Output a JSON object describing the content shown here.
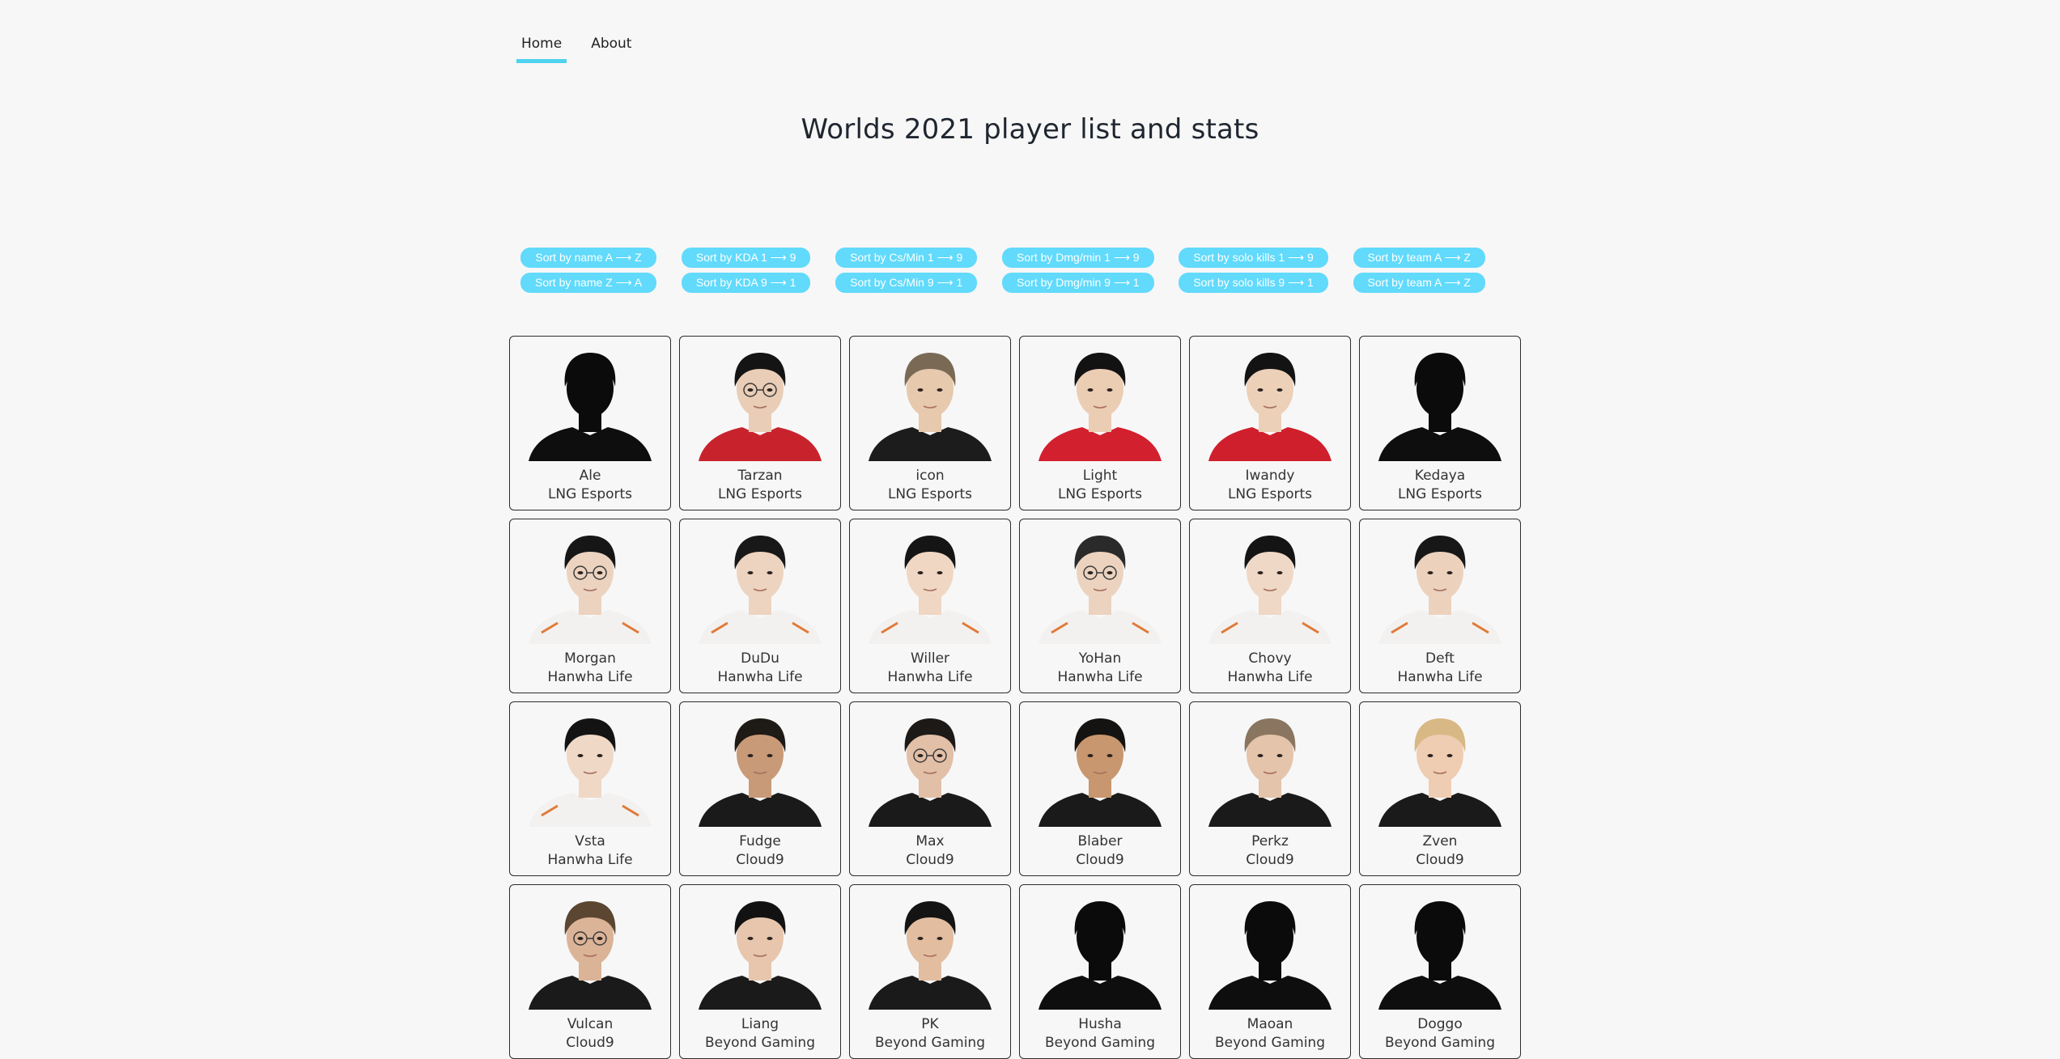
{
  "nav": {
    "items": [
      {
        "label": "Home",
        "active": true
      },
      {
        "label": "About",
        "active": false
      }
    ]
  },
  "title": "Worlds 2021 player list and stats",
  "sort_buttons": [
    [
      "Sort by name A ⟶ Z",
      "Sort by name Z ⟶ A"
    ],
    [
      "Sort by KDA 1 ⟶ 9",
      "Sort by KDA 9 ⟶ 1"
    ],
    [
      "Sort by Cs/Min 1 ⟶ 9",
      "Sort by Cs/Min 9 ⟶ 1"
    ],
    [
      "Sort by Dmg/min 1 ⟶ 9",
      "Sort by Dmg/min 9 ⟶ 1"
    ],
    [
      "Sort by solo kills 1 ⟶ 9",
      "Sort by solo kills 9 ⟶ 1"
    ],
    [
      "Sort by team A ⟶ Z",
      "Sort by team A ⟶ Z"
    ]
  ],
  "players": [
    {
      "name": "Ale",
      "team": "LNG Esports",
      "silhouette": true,
      "shirt": "#1a1a1a",
      "hair": "#111111",
      "skin": "#0c0c0c",
      "glasses": false
    },
    {
      "name": "Tarzan",
      "team": "LNG Esports",
      "silhouette": false,
      "shirt": "#c8232c",
      "hair": "#141414",
      "skin": "#e9cdb6",
      "glasses": true
    },
    {
      "name": "icon",
      "team": "LNG Esports",
      "silhouette": false,
      "shirt": "#1c1c1c",
      "hair": "#7a6a55",
      "skin": "#e7c9ae",
      "glasses": false
    },
    {
      "name": "Light",
      "team": "LNG Esports",
      "silhouette": false,
      "shirt": "#d3202e",
      "hair": "#121212",
      "skin": "#ebcdb4",
      "glasses": false
    },
    {
      "name": "Iwandy",
      "team": "LNG Esports",
      "silhouette": false,
      "shirt": "#d01f2c",
      "hair": "#131313",
      "skin": "#ecd0b8",
      "glasses": false
    },
    {
      "name": "Kedaya",
      "team": "LNG Esports",
      "silhouette": true,
      "shirt": "#1a1a1a",
      "hair": "#111111",
      "skin": "#0c0c0c",
      "glasses": false
    },
    {
      "name": "Morgan",
      "team": "Hanwha Life",
      "silhouette": false,
      "shirt": "#f3f1ef",
      "hair": "#161616",
      "skin": "#ecd3bf",
      "glasses": true
    },
    {
      "name": "DuDu",
      "team": "Hanwha Life",
      "silhouette": false,
      "shirt": "#f3f1ef",
      "hair": "#181818",
      "skin": "#edd4c0",
      "glasses": false
    },
    {
      "name": "Willer",
      "team": "Hanwha Life",
      "silhouette": false,
      "shirt": "#f3f1ef",
      "hair": "#151515",
      "skin": "#efd7c4",
      "glasses": false
    },
    {
      "name": "YoHan",
      "team": "Hanwha Life",
      "silhouette": false,
      "shirt": "#f3f1ef",
      "hair": "#2a2a2a",
      "skin": "#ecd3bf",
      "glasses": true
    },
    {
      "name": "Chovy",
      "team": "Hanwha Life",
      "silhouette": false,
      "shirt": "#f3f1ef",
      "hair": "#141414",
      "skin": "#efd8c6",
      "glasses": false
    },
    {
      "name": "Deft",
      "team": "Hanwha Life",
      "silhouette": false,
      "shirt": "#f3f1ef",
      "hair": "#171717",
      "skin": "#ecd2bd",
      "glasses": false
    },
    {
      "name": "Vsta",
      "team": "Hanwha Life",
      "silhouette": false,
      "shirt": "#f3f1ef",
      "hair": "#131313",
      "skin": "#efd8c6",
      "glasses": false
    },
    {
      "name": "Fudge",
      "team": "Cloud9",
      "silhouette": false,
      "shirt": "#1a1a1a",
      "hair": "#1e1a16",
      "skin": "#c99a78",
      "glasses": false
    },
    {
      "name": "Max",
      "team": "Cloud9",
      "silhouette": false,
      "shirt": "#1a1a1a",
      "hair": "#1c1917",
      "skin": "#e2bfa7",
      "glasses": true
    },
    {
      "name": "Blaber",
      "team": "Cloud9",
      "silhouette": false,
      "shirt": "#1a1a1a",
      "hair": "#151311",
      "skin": "#c8976f",
      "glasses": false
    },
    {
      "name": "Perkz",
      "team": "Cloud9",
      "silhouette": false,
      "shirt": "#1a1a1a",
      "hair": "#8a7560",
      "skin": "#e4c4ab",
      "glasses": false
    },
    {
      "name": "Zven",
      "team": "Cloud9",
      "silhouette": false,
      "shirt": "#1a1a1a",
      "hair": "#d8b884",
      "skin": "#efcdb3",
      "glasses": false
    },
    {
      "name": "Vulcan",
      "team": "Cloud9",
      "silhouette": false,
      "shirt": "#1a1a1a",
      "hair": "#5b4632",
      "skin": "#dbb397",
      "glasses": true
    },
    {
      "name": "Liang",
      "team": "Beyond Gaming",
      "silhouette": false,
      "shirt": "#1a1a1a",
      "hair": "#121212",
      "skin": "#e7c6ad",
      "glasses": false
    },
    {
      "name": "PK",
      "team": "Beyond Gaming",
      "silhouette": false,
      "shirt": "#1a1a1a",
      "hair": "#141414",
      "skin": "#e2bda0",
      "glasses": false
    },
    {
      "name": "Husha",
      "team": "Beyond Gaming",
      "silhouette": true,
      "shirt": "#1a1a1a",
      "hair": "#111111",
      "skin": "#0c0c0c",
      "glasses": false
    },
    {
      "name": "Maoan",
      "team": "Beyond Gaming",
      "silhouette": true,
      "shirt": "#1a1a1a",
      "hair": "#111111",
      "skin": "#0c0c0c",
      "glasses": false
    },
    {
      "name": "Doggo",
      "team": "Beyond Gaming",
      "silhouette": true,
      "shirt": "#1a1a1a",
      "hair": "#111111",
      "skin": "#0c0c0c",
      "glasses": false
    }
  ]
}
